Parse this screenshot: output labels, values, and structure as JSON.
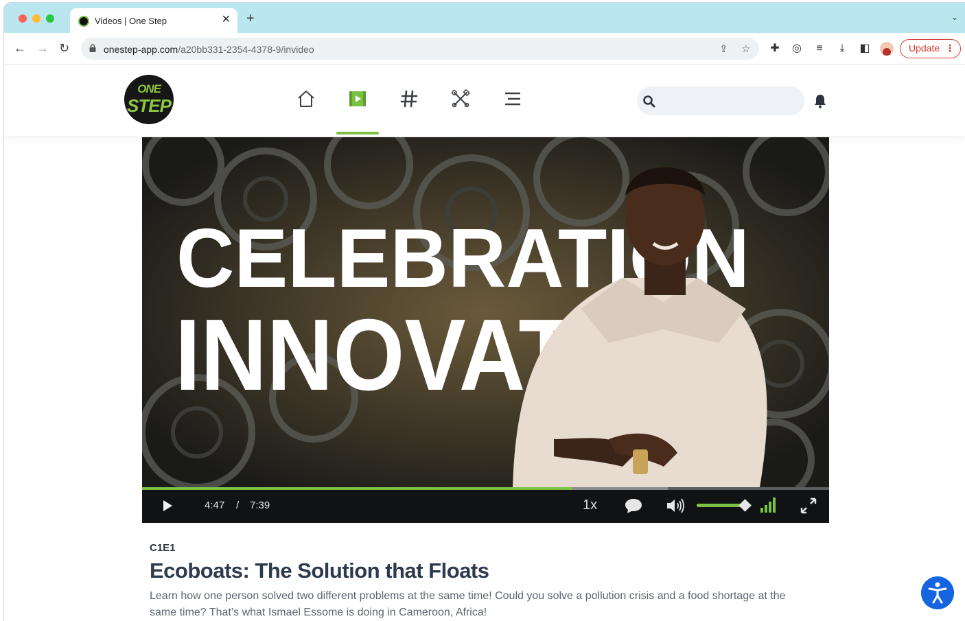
{
  "browser": {
    "tab_title": "Videos | One Step",
    "url_host": "onestep-app.com",
    "url_path": "/a20bb331-2354-4378-9/invideo",
    "update_label": "Update"
  },
  "app": {
    "logo_line1": "ONE",
    "logo_line2": "STEP",
    "accent_color": "#7ac143",
    "nav_items": [
      "home",
      "videos",
      "hashtags",
      "tools",
      "menu"
    ],
    "active_nav": "videos",
    "search_placeholder": ""
  },
  "video": {
    "overlay_line1": "CELEBRATION",
    "overlay_line2": "INNOVATION",
    "current_time": "4:47",
    "separator": "/",
    "duration": "7:39",
    "progress_fraction": 0.626,
    "buffered_fraction": 0.765,
    "speed": "1x",
    "volume_fraction": 0.88
  },
  "episode": {
    "code": "C1E1",
    "title": "Ecoboats: The Solution that Floats",
    "description": "Learn how one person solved two different problems at the same time! Could you solve a pollution crisis and a food shortage at the same time? That’s what Ismael Essome is doing in Cameroon, Africa!"
  }
}
